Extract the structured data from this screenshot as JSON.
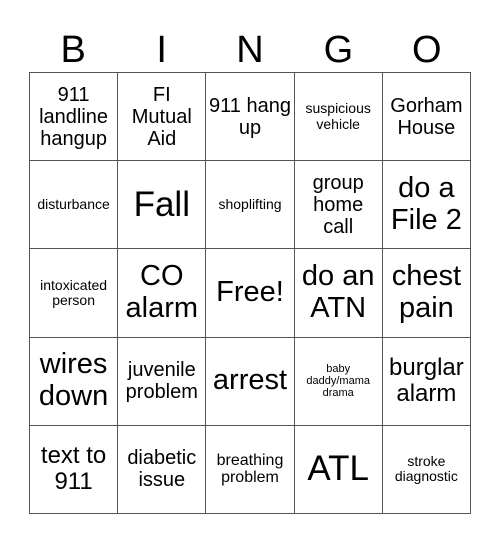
{
  "header": [
    "B",
    "I",
    "N",
    "G",
    "O"
  ],
  "cells": [
    {
      "text": "911 landline hangup",
      "size": "m"
    },
    {
      "text": "FI Mutual Aid",
      "size": "m"
    },
    {
      "text": "911 hang up",
      "size": "m"
    },
    {
      "text": "suspicious vehicle",
      "size": "s"
    },
    {
      "text": "Gorham House",
      "size": "m"
    },
    {
      "text": "disturbance",
      "size": "s"
    },
    {
      "text": "Fall",
      "size": "xxl"
    },
    {
      "text": "shoplifting",
      "size": "s"
    },
    {
      "text": "group home call",
      "size": "m"
    },
    {
      "text": "do a File 2",
      "size": "xl"
    },
    {
      "text": "intoxicated person",
      "size": "s"
    },
    {
      "text": "CO alarm",
      "size": "xl"
    },
    {
      "text": "Free!",
      "size": "xl"
    },
    {
      "text": "do an ATN",
      "size": "xl"
    },
    {
      "text": "chest pain",
      "size": "xl"
    },
    {
      "text": "wires down",
      "size": "xl"
    },
    {
      "text": "juvenile problem",
      "size": "m"
    },
    {
      "text": "arrest",
      "size": "xl"
    },
    {
      "text": "baby daddy/mama drama",
      "size": "xs"
    },
    {
      "text": "burglar alarm",
      "size": "l"
    },
    {
      "text": "text to 911",
      "size": "l"
    },
    {
      "text": "diabetic issue",
      "size": "m"
    },
    {
      "text": "breathing problem",
      "size": "sm"
    },
    {
      "text": "ATL",
      "size": "xxl"
    },
    {
      "text": "stroke diagnostic",
      "size": "s"
    }
  ]
}
